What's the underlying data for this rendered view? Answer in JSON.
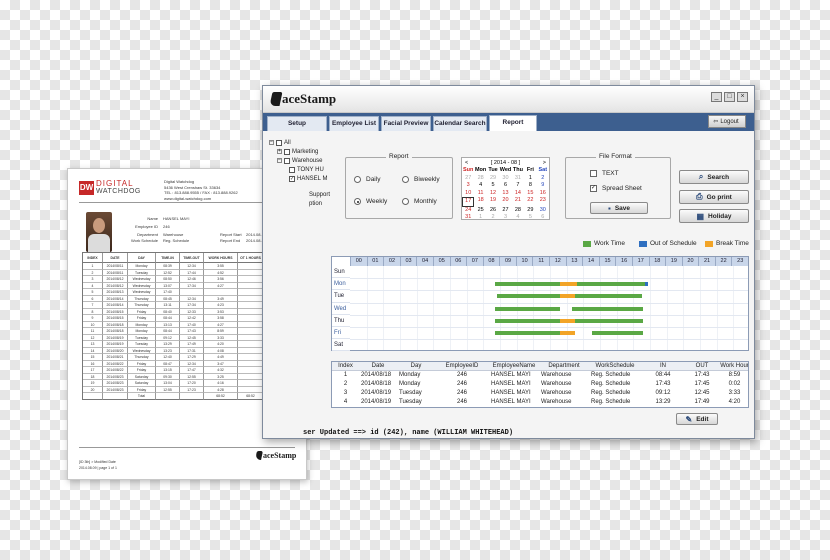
{
  "app": {
    "logo_text": "aceStamp",
    "window_buttons": [
      "_",
      "□",
      "×"
    ],
    "tabs": [
      {
        "label": "Setup"
      },
      {
        "label": "Employee List"
      },
      {
        "label": "Facial Preview"
      },
      {
        "label": "Calendar Search"
      },
      {
        "label": "Report",
        "active": true
      }
    ],
    "logout_label": "Logout",
    "tree": {
      "root": "All",
      "items": [
        "Marketing",
        "Warehouse",
        "TONY HU",
        "HANSEL M",
        "Support",
        "ption"
      ]
    },
    "report_group": {
      "title": "Report",
      "options": [
        "Daily",
        "Weekly",
        "Biweekly",
        "Monthly"
      ],
      "selected": "Weekly"
    },
    "calendar": {
      "prev": "<",
      "next": ">",
      "month_label": "[ 2014 - 08 ]",
      "dows": [
        "Sun",
        "Mon",
        "Tue",
        "Wed",
        "Thu",
        "Fri",
        "Sat"
      ],
      "weeks": [
        [
          "27",
          "28",
          "29",
          "30",
          "31",
          "1",
          "2"
        ],
        [
          "3",
          "4",
          "5",
          "6",
          "7",
          "8",
          "9"
        ],
        [
          "10",
          "11",
          "12",
          "13",
          "14",
          "15",
          "16"
        ],
        [
          "17",
          "18",
          "19",
          "20",
          "21",
          "22",
          "23"
        ],
        [
          "24",
          "25",
          "26",
          "27",
          "28",
          "29",
          "30"
        ],
        [
          "31",
          "1",
          "2",
          "3",
          "4",
          "5",
          "6"
        ]
      ]
    },
    "file_format": {
      "title": "File Format",
      "options": [
        {
          "label": "TEXT",
          "checked": false
        },
        {
          "label": "Spread Sheet",
          "checked": true
        }
      ],
      "save_label": "Save"
    },
    "actions": {
      "search_label": "Search",
      "print_label": "Go print",
      "holiday_label": "Holiday"
    },
    "legend": [
      {
        "label": "Work Time",
        "color": "#5aa845"
      },
      {
        "label": "Out of Schedule",
        "color": "#2f6fc0"
      },
      {
        "label": "Break Time",
        "color": "#f2a427"
      }
    ],
    "schedule": {
      "hours": [
        "00",
        "01",
        "02",
        "03",
        "04",
        "05",
        "06",
        "07",
        "08",
        "09",
        "10",
        "11",
        "12",
        "13",
        "14",
        "15",
        "16",
        "17",
        "18",
        "19",
        "20",
        "21",
        "22",
        "23"
      ],
      "days": [
        "Sun",
        "Mon",
        "Tue",
        "Wed",
        "Thu",
        "Fri",
        "Sat"
      ]
    },
    "data_table": {
      "headers": [
        "Index",
        "Date",
        "Day",
        "EmployeeID",
        "EmployeeName",
        "Department",
        "WorkSchedule",
        "IN",
        "OUT",
        "Work Hour"
      ],
      "rows": [
        [
          "1",
          "2014/08/18",
          "Monday",
          "246",
          "HANSEL MAYI",
          "Warehouse",
          "Reg. Schedule",
          "08:44",
          "17:43",
          "8:59"
        ],
        [
          "2",
          "2014/08/18",
          "Monday",
          "246",
          "HANSEL MAYI",
          "Warehouse",
          "Reg. Schedule",
          "17:43",
          "17:45",
          "0:02"
        ],
        [
          "3",
          "2014/08/19",
          "Tuesday",
          "246",
          "HANSEL MAYI",
          "Warehouse",
          "Reg. Schedule",
          "09:12",
          "12:45",
          "3:33"
        ],
        [
          "4",
          "2014/08/19",
          "Tuesday",
          "246",
          "HANSEL MAYI",
          "Warehouse",
          "Reg. Schedule",
          "13:29",
          "17:49",
          "4:20"
        ]
      ]
    },
    "edit_label": "Edit",
    "status_text": "ser Updated ==> id (242), name (WILLIAM WHITEHEAD)"
  },
  "paper": {
    "logo_mark": "DW",
    "logo_top": "DIGITAL",
    "logo_bottom": "WATCHDOG",
    "address": [
      "Digital Watchdog",
      "5436 West Crenshaw St. 33634",
      "TEL : 813.888.9555 / FAX : 813.888.9262",
      "www.digital-watchdog.com"
    ],
    "info_left": [
      {
        "label": "Name",
        "value": "HANSEL MAYI"
      },
      {
        "label": "Employee ID",
        "value": "246"
      },
      {
        "label": "Department",
        "value": "Warehouse"
      },
      {
        "label": "Work Schedule",
        "value": "Reg. Schedule"
      }
    ],
    "info_right": [
      {
        "label": "Report Start",
        "value": "2014.08.10"
      },
      {
        "label": "Report End",
        "value": "2014.08.23"
      }
    ],
    "table_headers": [
      "INDEX",
      "DATE",
      "DAY",
      "TIME-IN",
      "TIME-OUT",
      "WORK HOURS",
      "OT 1 HOURS",
      "2OT HOURS"
    ],
    "table_rows": [
      [
        "1",
        "2014/08/11",
        "Monday",
        "08:39",
        "12:34",
        "3:55",
        "",
        ""
      ],
      [
        "2",
        "2014/08/11",
        "Tuesday",
        "12:52",
        "17:44",
        "4:52",
        "",
        ""
      ],
      [
        "3",
        "2014/08/12",
        "Wednesday",
        "08:50",
        "12:46",
        "3:56",
        "",
        ""
      ],
      [
        "4",
        "2014/08/12",
        "Wednesday",
        "13:07",
        "17:34",
        "4:27",
        "",
        ""
      ],
      [
        "5",
        "2014/08/13",
        "Wednesday",
        "17:40",
        "",
        "",
        "",
        ""
      ],
      [
        "6",
        "2014/08/14",
        "Thursday",
        "08:45",
        "12:34",
        "3:49",
        "",
        ""
      ],
      [
        "7",
        "2014/08/14",
        "Thursday",
        "13:11",
        "17:34",
        "4:23",
        "",
        ""
      ],
      [
        "8",
        "2014/08/15",
        "Friday",
        "08:40",
        "12:33",
        "3:53",
        "",
        ""
      ],
      [
        "9",
        "2014/08/15",
        "Friday",
        "08:44",
        "12:42",
        "3:58",
        "",
        ""
      ],
      [
        "10",
        "2014/08/18",
        "Monday",
        "13:13",
        "17:40",
        "4:27",
        "",
        ""
      ],
      [
        "11",
        "2014/08/18",
        "Monday",
        "08:44",
        "17:43",
        "8:59",
        "",
        ""
      ],
      [
        "12",
        "2014/08/19",
        "Tuesday",
        "09:12",
        "12:45",
        "3:33",
        "",
        ""
      ],
      [
        "13",
        "2014/08/19",
        "Tuesday",
        "13:29",
        "17:49",
        "4:20",
        "",
        ""
      ],
      [
        "14",
        "2014/08/20",
        "Wednesday",
        "13:23",
        "17:31",
        "4:08",
        "",
        ""
      ],
      [
        "15",
        "2014/08/21",
        "Thursday",
        "12:40",
        "17:29",
        "4:49",
        "",
        ""
      ],
      [
        "16",
        "2014/08/22",
        "Friday",
        "08:47",
        "12:34",
        "3:47",
        "",
        ""
      ],
      [
        "17",
        "2014/08/22",
        "Friday",
        "13:15",
        "17:47",
        "4:32",
        "",
        ""
      ],
      [
        "18",
        "2014/08/23",
        "Saturday",
        "09:30",
        "12:55",
        "3:25",
        "",
        ""
      ],
      [
        "19",
        "2014/08/23",
        "Saturday",
        "13:04",
        "17:20",
        "4:16",
        "",
        ""
      ],
      [
        "20",
        "2014/08/23",
        "Friday",
        "12:55",
        "17:23",
        "4:28",
        "",
        ""
      ]
    ],
    "total_row": [
      "",
      "",
      "Total",
      "",
      "",
      "68:52",
      "68:52",
      "0:00"
    ],
    "footer_lines": [
      "[ID 3th] > Modified Date",
      "2014.08.09   |   page 1 of 1"
    ],
    "footer_logo": "aceStamp"
  }
}
